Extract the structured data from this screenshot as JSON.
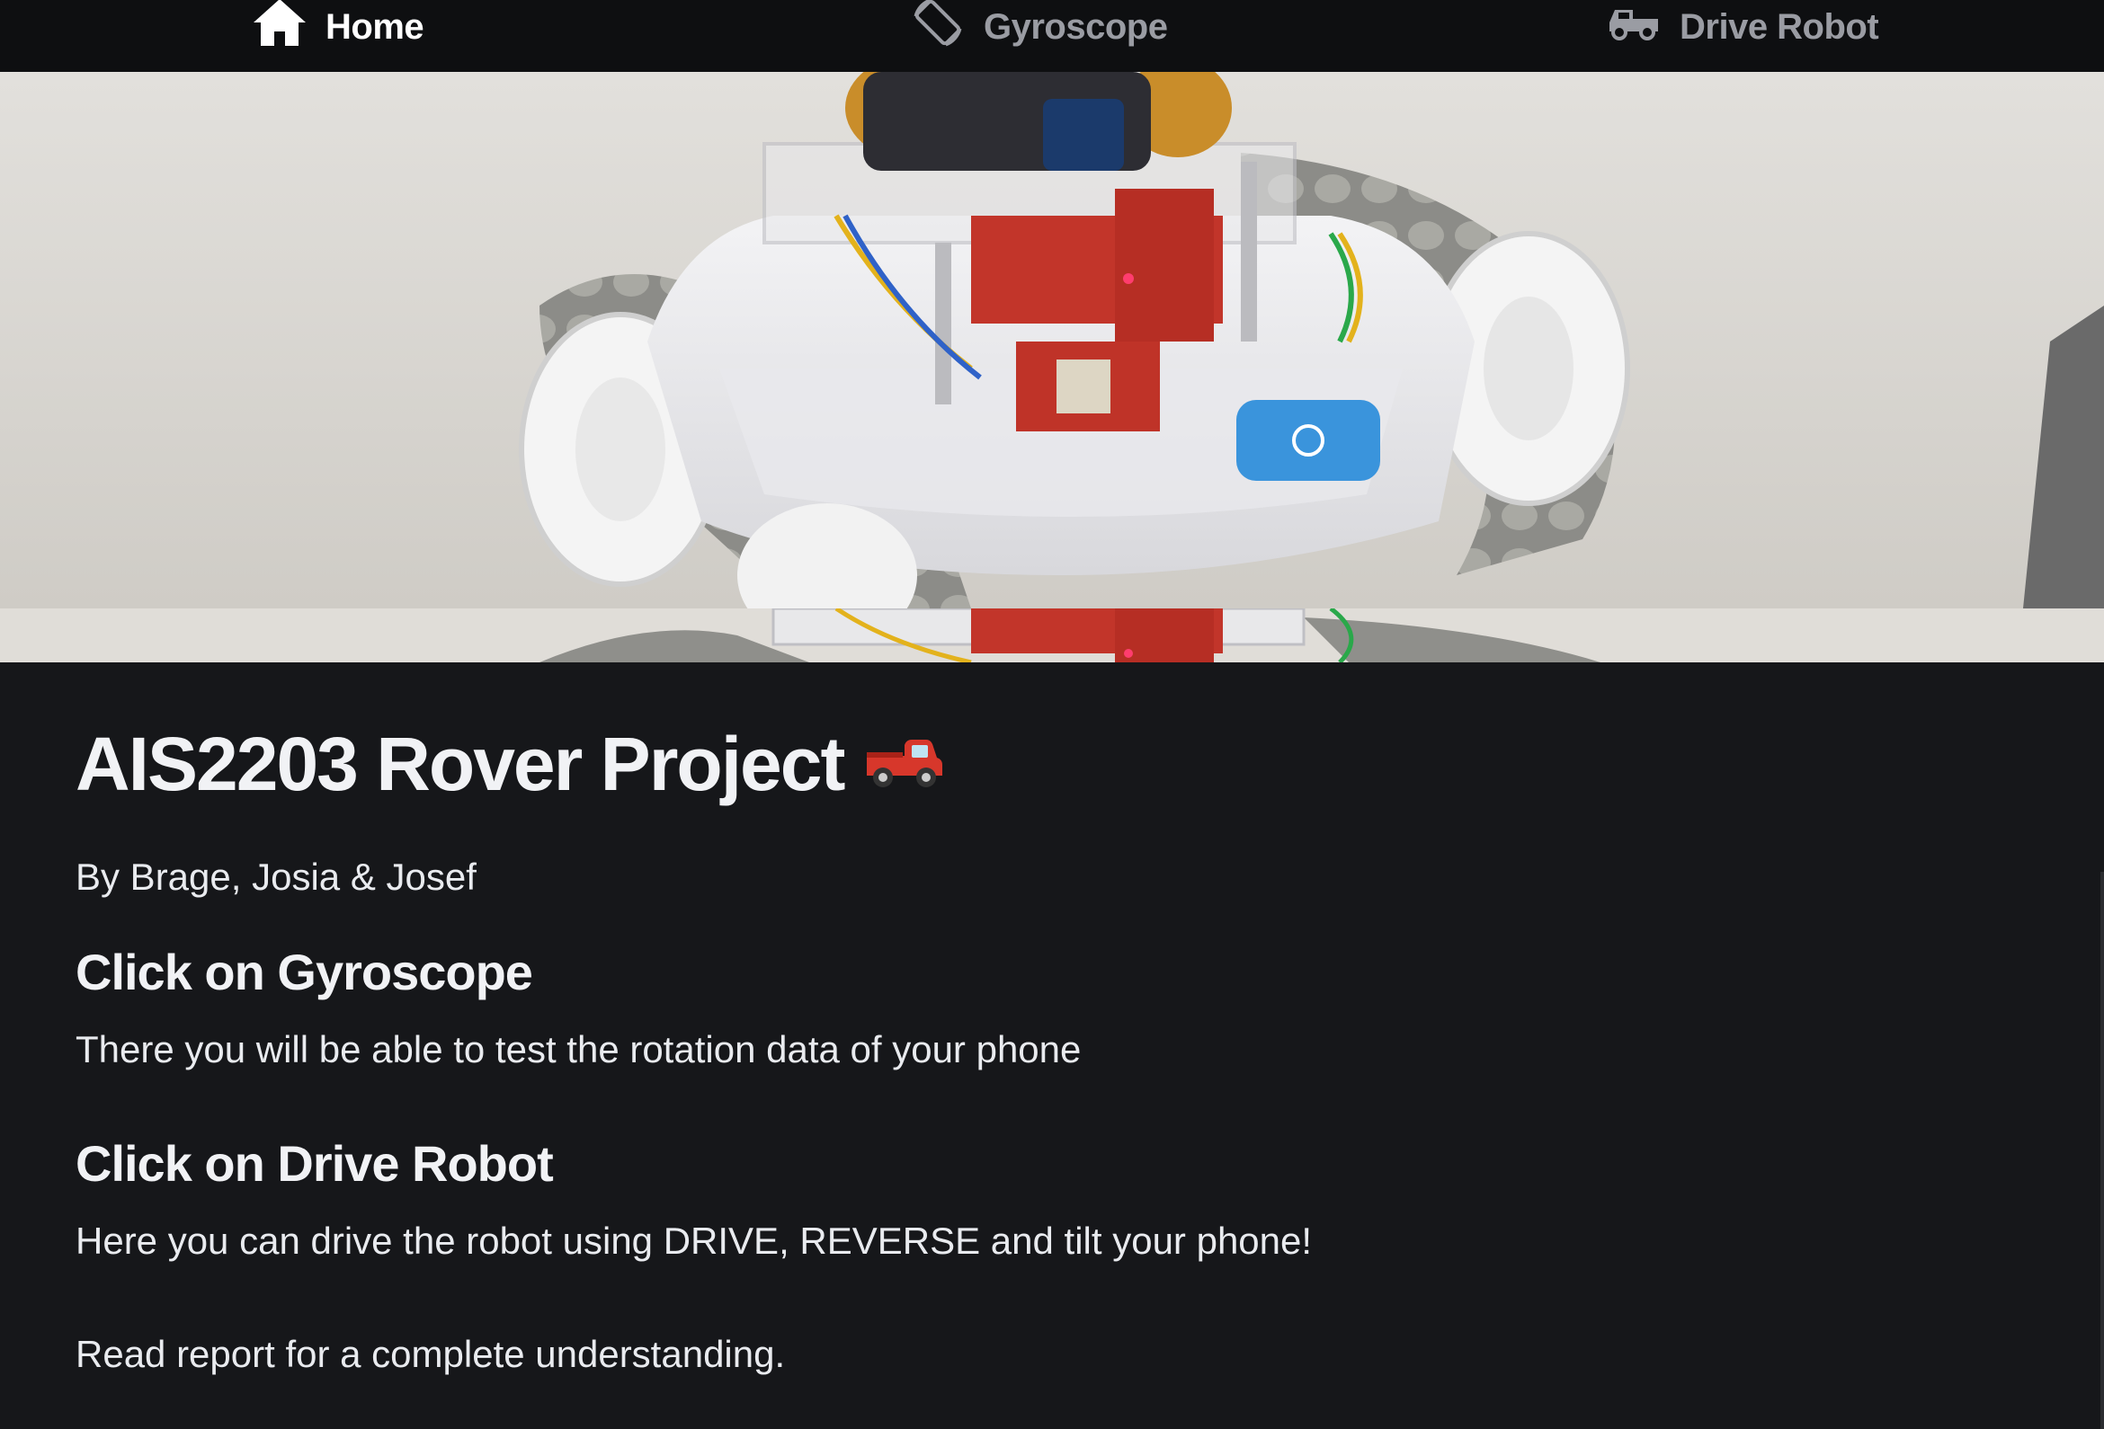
{
  "nav": {
    "items": [
      {
        "label": "Home",
        "icon": "home-icon",
        "active": true
      },
      {
        "label": "Gyroscope",
        "icon": "screen-rotation-icon",
        "active": false
      },
      {
        "label": "Drive Robot",
        "icon": "car-icon",
        "active": false
      }
    ]
  },
  "main": {
    "title": "AIS2203 Rover Project",
    "title_emoji": "pickup-truck-emoji",
    "authors": "By Brage, Josia & Josef",
    "gyro_heading": "Click on Gyroscope",
    "gyro_text": "There you will be able to test the rotation data of your phone",
    "drive_heading": "Click on Drive Robot",
    "drive_text": "Here you can drive the robot using DRIVE, REVERSE and tilt your phone!",
    "report_text": "Read report for a complete understanding."
  },
  "colors": {
    "background": "#16171a",
    "nav_background": "#0e0f11",
    "nav_active": "#ffffff",
    "nav_inactive": "#9a9ca3",
    "text": "#eceef2"
  }
}
